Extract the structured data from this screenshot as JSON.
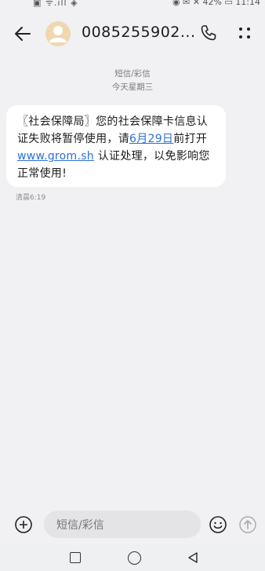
{
  "status_bar": {
    "left": "▣ ᯤ.ıll ◈",
    "right": "◉ ✉ ✕ 42% ▭ 11:14"
  },
  "header": {
    "contact": "0085255902..."
  },
  "conversation": {
    "type_label": "短信/彩信",
    "date": "今天星期三"
  },
  "message": {
    "text_1": "〖社会保障局〗您的社会保障卡信息认证失败将暂停使用，请",
    "link_date": "6月29日",
    "text_2": "前打开 ",
    "link_url": "www.grom.sh",
    "text_3": " 认证处理，以免影响您正常使用!",
    "time": "清晨6:19"
  },
  "composer": {
    "placeholder": "短信/彩信"
  },
  "icons": {
    "back": "back-arrow-icon",
    "avatar": "person-avatar-icon",
    "call": "phone-icon",
    "more": "more-dots-icon",
    "plus": "plus-circle-icon",
    "emoji": "emoji-icon",
    "send": "send-arrow-icon",
    "nav_recent": "square-icon",
    "nav_home": "circle-icon",
    "nav_back": "triangle-back-icon"
  }
}
